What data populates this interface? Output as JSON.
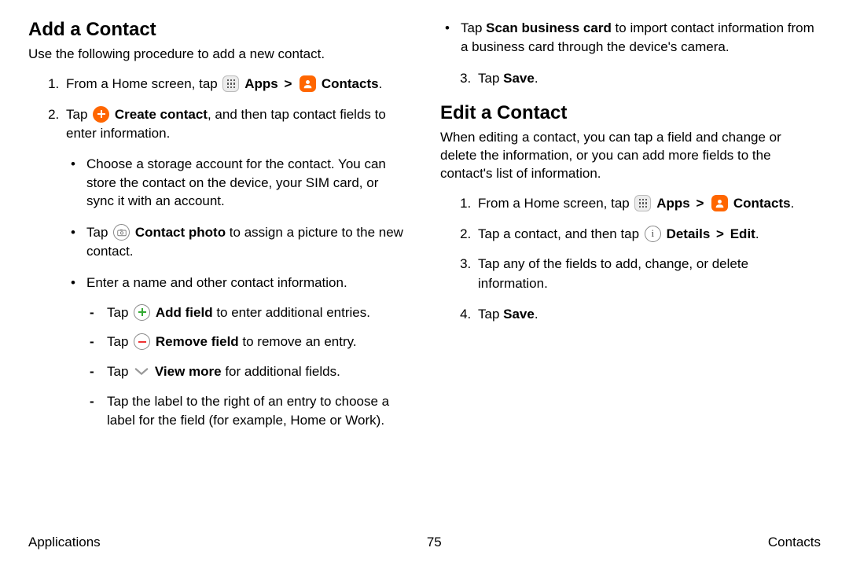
{
  "left": {
    "heading": "Add a Contact",
    "intro": "Use the following procedure to add a new contact.",
    "step1_pre": "From a Home screen, tap ",
    "apps": "Apps",
    "gt": ">",
    "contacts": "Contacts",
    "step2_pre": "Tap ",
    "create": "Create contact",
    "step2_post": ", and then tap contact fields to enter information.",
    "b1": "Choose a storage account for the contact. You can store the contact on the device, your SIM card, or sync it with an account.",
    "b2_pre": "Tap ",
    "b2_bold": "Contact photo",
    "b2_post": " to assign a picture to the new contact.",
    "b3": "Enter a name and other contact information.",
    "d1_pre": "Tap ",
    "d1_bold": "Add field",
    "d1_post": " to enter additional entries.",
    "d2_pre": "Tap ",
    "d2_bold": "Remove field",
    "d2_post": " to remove an entry.",
    "d3_pre": "Tap ",
    "d3_bold": "View more",
    "d3_post": " for additional fields.",
    "d4": "Tap the label to the right of an entry to choose a label for the field (for example, Home or Work)."
  },
  "right": {
    "cont_b_pre": "Tap ",
    "cont_b_bold": "Scan business card",
    "cont_b_post": " to import contact information from a business card through the device's camera.",
    "step3_pre": "Tap ",
    "step3_bold": "Save",
    "heading": "Edit a Contact",
    "intro": "When editing a contact, you can tap a field and change or delete the information, or you can add more fields to the contact's list of information.",
    "e1_pre": "From a Home screen, tap ",
    "apps": "Apps",
    "gt": ">",
    "contacts": "Contacts",
    "e2_pre": "Tap a contact, and then tap ",
    "e2_bold": "Details",
    "e2_gt": ">",
    "e2_bold2": "Edit",
    "e3": "Tap any of the fields to add, change, or delete information.",
    "e4_pre": "Tap ",
    "e4_bold": "Save"
  },
  "footer": {
    "left": "Applications",
    "center": "75",
    "right": "Contacts"
  }
}
